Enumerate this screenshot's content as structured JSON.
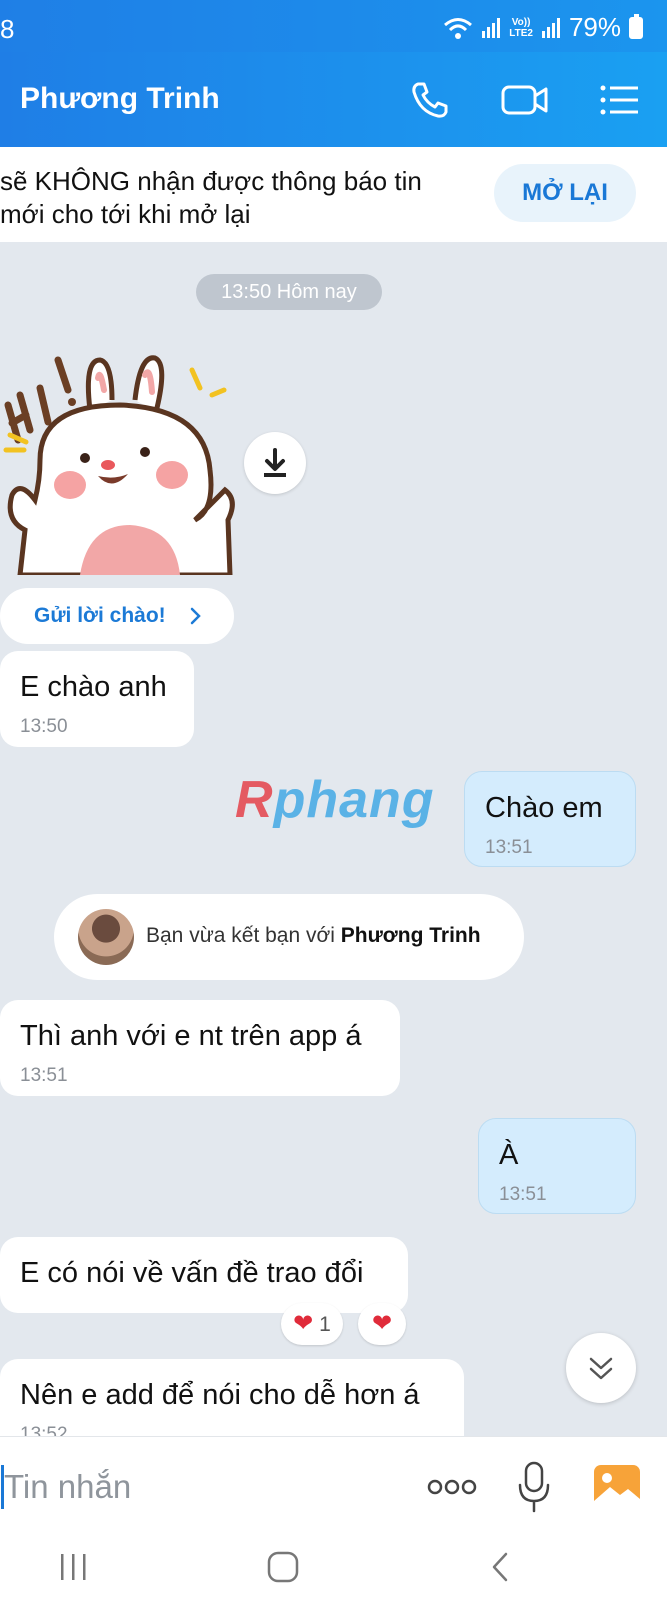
{
  "status_bar": {
    "time": "8",
    "network_label_top": "Vo))",
    "network_label_bottom": "LTE2",
    "battery": "79%"
  },
  "header": {
    "title": "Phương Trinh"
  },
  "mute_banner": {
    "text": "sẽ KHÔNG nhận được thông báo tin mới cho tới khi mở lại",
    "button": "MỞ LẠI"
  },
  "messages": {
    "date_pill": "13:50 Hôm nay",
    "greeting_chip": "Gửi lời chào!",
    "m1": {
      "text": "E chào anh",
      "time": "13:50"
    },
    "m2": {
      "text": "Chào em",
      "time": "13:51"
    },
    "friend_notice": {
      "prefix": "Bạn vừa kết bạn với ",
      "name": "Phương Trinh"
    },
    "m3": {
      "text": "Thì anh với e nt trên app á",
      "time": "13:51"
    },
    "m4": {
      "text": "À",
      "time": "13:51"
    },
    "m5": {
      "text": "E có nói về vấn đề trao đổi",
      "reaction_count": "1"
    },
    "m6": {
      "text": "Nên e add để nói cho dễ hơn á",
      "time": "13:52"
    }
  },
  "watermark": {
    "first": "R",
    "rest": "phang"
  },
  "composer": {
    "placeholder": "Tin nhắn"
  },
  "colors": {
    "header": "#1f7fe6",
    "accent": "#1a78d6",
    "outgoing_bubble": "#d4ecfd",
    "chat_bg": "#e3e8ee"
  },
  "icons": [
    "phone-icon",
    "video-call-icon",
    "menu-list-icon",
    "download-icon",
    "chevron-right-icon",
    "heart-icon",
    "double-chevron-down-icon",
    "more-icon",
    "microphone-icon",
    "gallery-icon",
    "recent-apps-icon",
    "home-icon",
    "back-icon"
  ]
}
